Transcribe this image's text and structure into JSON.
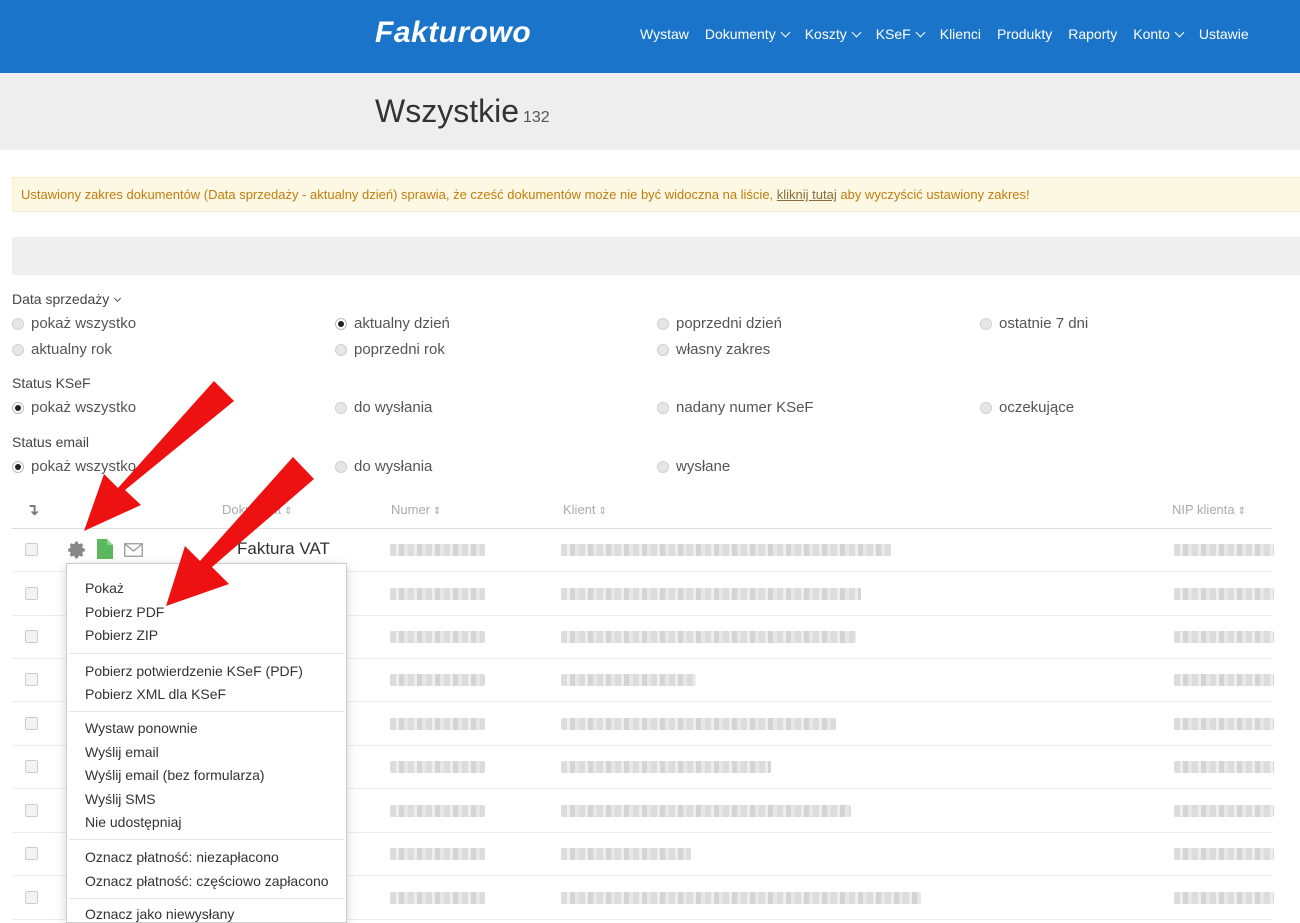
{
  "brand": "Fakturowo",
  "nav": [
    {
      "label": "Wystaw",
      "dropdown": false
    },
    {
      "label": "Dokumenty",
      "dropdown": true
    },
    {
      "label": "Koszty",
      "dropdown": true
    },
    {
      "label": "KSeF",
      "dropdown": true
    },
    {
      "label": "Klienci",
      "dropdown": false
    },
    {
      "label": "Produkty",
      "dropdown": false
    },
    {
      "label": "Raporty",
      "dropdown": false
    },
    {
      "label": "Konto",
      "dropdown": true
    },
    {
      "label": "Ustawie",
      "dropdown": false
    }
  ],
  "page": {
    "title": "Wszystkie",
    "count": "132"
  },
  "alert": {
    "before": "Ustawiony zakres dokumentów (Data sprzedaży - aktualny dzień) sprawia, że cześć dokumentów może nie być widoczna na liście, ",
    "link": "kliknij tutaj",
    "after": " aby wyczyścić ustawiony zakres!"
  },
  "filters": {
    "sale_date": {
      "title": "Data sprzedaży",
      "options": [
        "pokaż wszystko",
        "aktualny dzień",
        "poprzedni dzień",
        "ostatnie 7 dni",
        "aktualny rok",
        "poprzedni rok",
        "własny zakres"
      ],
      "selected": "aktualny dzień"
    },
    "ksef_status": {
      "title": "Status KSeF",
      "options": [
        "pokaż wszystko",
        "do wysłania",
        "nadany numer KSeF",
        "oczekujące"
      ],
      "selected": "pokaż wszystko"
    },
    "email_status": {
      "title": "Status email",
      "options": [
        "pokaż wszystko",
        "do wysłania",
        "wysłane"
      ],
      "selected": "pokaż wszystko"
    }
  },
  "table": {
    "columns": {
      "sort": "↴",
      "document": "Dokument",
      "number": "Numer",
      "client": "Klient",
      "nip": "NIP klienta"
    },
    "sort_glyph": "⇕",
    "first_row_type": "Faktura VAT",
    "row_count": 9
  },
  "menu": {
    "groups": [
      [
        "Pokaż",
        "Pobierz PDF",
        "Pobierz ZIP"
      ],
      [
        "Pobierz potwierdzenie KSeF (PDF)",
        "Pobierz XML dla KSeF"
      ],
      [
        "Wystaw ponownie",
        "Wyślij email",
        "Wyślij email (bez formularza)",
        "Wyślij SMS",
        "Nie udostępniaj"
      ],
      [
        "Oznacz płatność: niezapłacono",
        "Oznacz płatność: częściowo zapłacono"
      ],
      [
        "Oznacz jako niewysłany"
      ]
    ]
  },
  "colors": {
    "navbar": "#1a74c9",
    "alert_bg": "#fcf8e3",
    "alert_text": "#c27c0e",
    "arrow": "#ee1111",
    "file_icon": "#5cb85c"
  }
}
